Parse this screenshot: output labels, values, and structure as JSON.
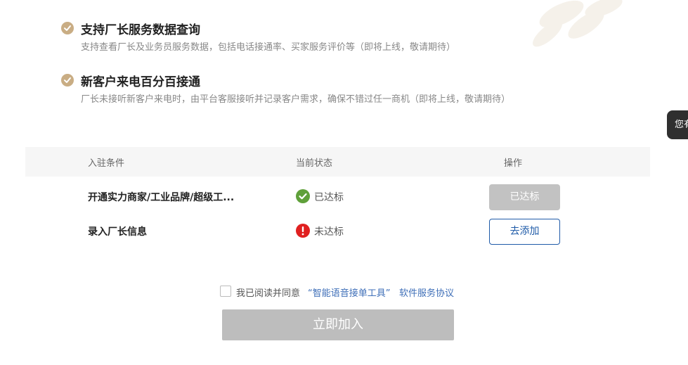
{
  "features": [
    {
      "title": "支持厂长服务数据查询",
      "desc": "支持查看厂长及业务员服务数据，包括电话接通率、买家服务评价等（即将上线，敬请期待）"
    },
    {
      "title": "新客户来电百分百接通",
      "desc": "厂长未接听新客户来电时，由平台客服接听并记录客户需求，确保不错过任一商机（即将上线，敬请期待）"
    }
  ],
  "side_tab": {
    "label": "您有"
  },
  "table": {
    "headers": {
      "condition": "入驻条件",
      "status": "当前状态",
      "action": "操作"
    },
    "rows": [
      {
        "condition": "开通实力商家/工业品牌/超级工...",
        "status": "已达标",
        "status_icon": "check-circle-icon",
        "action": "已达标"
      },
      {
        "condition": "录入厂长信息",
        "status": "未达标",
        "status_icon": "alert-circle-icon",
        "action": "去添加"
      }
    ]
  },
  "agreement": {
    "prefix": "我已阅读并同意",
    "tool_name": "“智能语音接单工具”",
    "link": "软件服务协议",
    "checked": false
  },
  "join_button": {
    "label": "立即加入"
  },
  "colors": {
    "gold": "#c9ad84",
    "success": "#5fa03a",
    "danger": "#e02020",
    "link_blue": "#3f6fb8",
    "disabled_gray": "#bdbdbd"
  }
}
